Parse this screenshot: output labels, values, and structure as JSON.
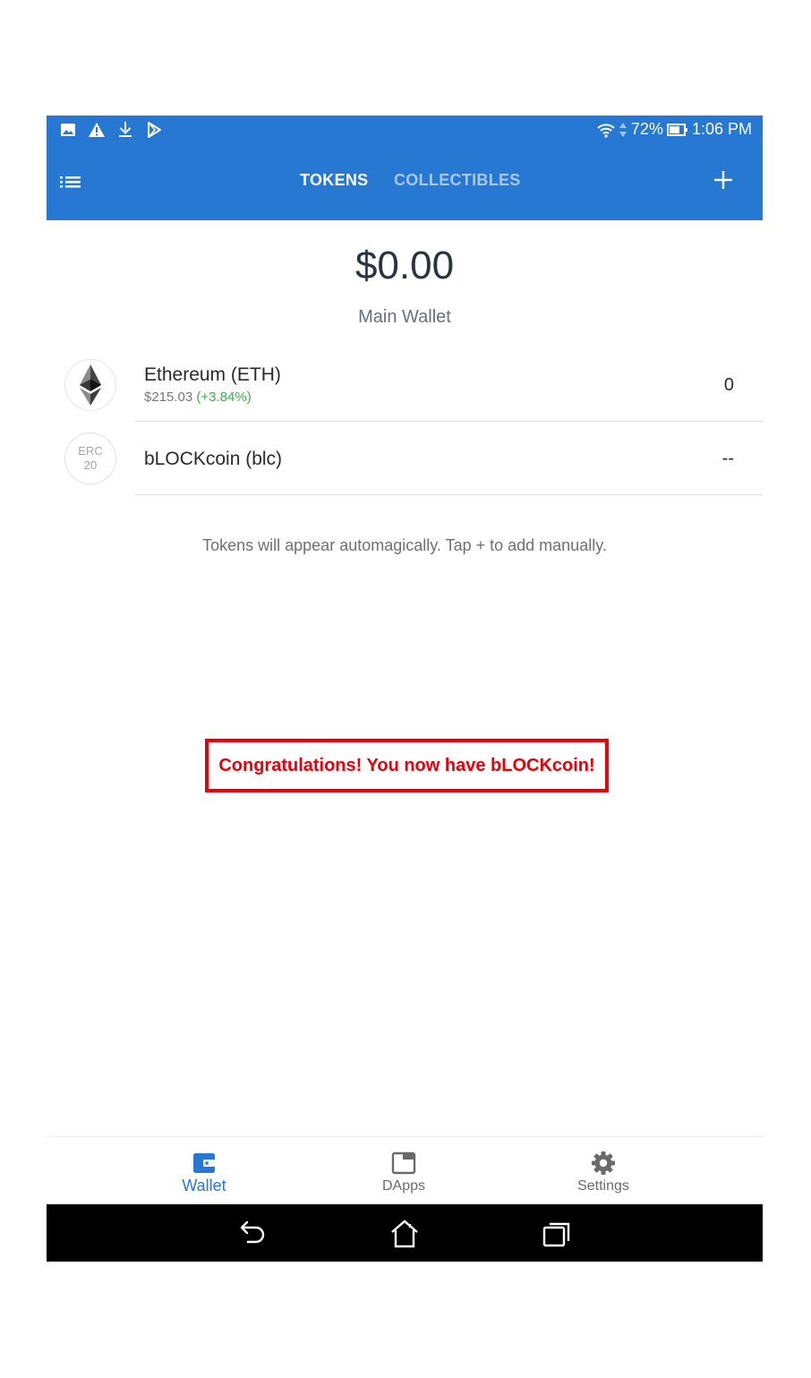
{
  "status_bar": {
    "icons_left": [
      "image-icon",
      "warning-icon",
      "download-icon",
      "play-store-icon"
    ],
    "battery_percent": "72%",
    "time": "1:06 PM"
  },
  "header": {
    "tabs": [
      {
        "label": "TOKENS",
        "active": true
      },
      {
        "label": "COLLECTIBLES",
        "active": false
      }
    ],
    "accent_color": "#2778d3"
  },
  "balance": {
    "total": "$0.00",
    "wallet_name": "Main Wallet"
  },
  "tokens": [
    {
      "name": "Ethereum (ETH)",
      "price": "$215.03",
      "change": "(+3.84%)",
      "amount": "0",
      "icon": "ethereum-icon"
    },
    {
      "name": "bLOCKcoin (blc)",
      "icon_line1": "ERC",
      "icon_line2": "20",
      "amount": "--",
      "icon": "erc20-icon"
    }
  ],
  "hint": "Tokens will appear automagically. Tap + to add manually.",
  "congrats": "Congratulations! You now have bLOCKcoin!",
  "bottom_nav": [
    {
      "label": "Wallet",
      "active": true
    },
    {
      "label": "DApps",
      "active": false
    },
    {
      "label": "Settings",
      "active": false
    }
  ]
}
